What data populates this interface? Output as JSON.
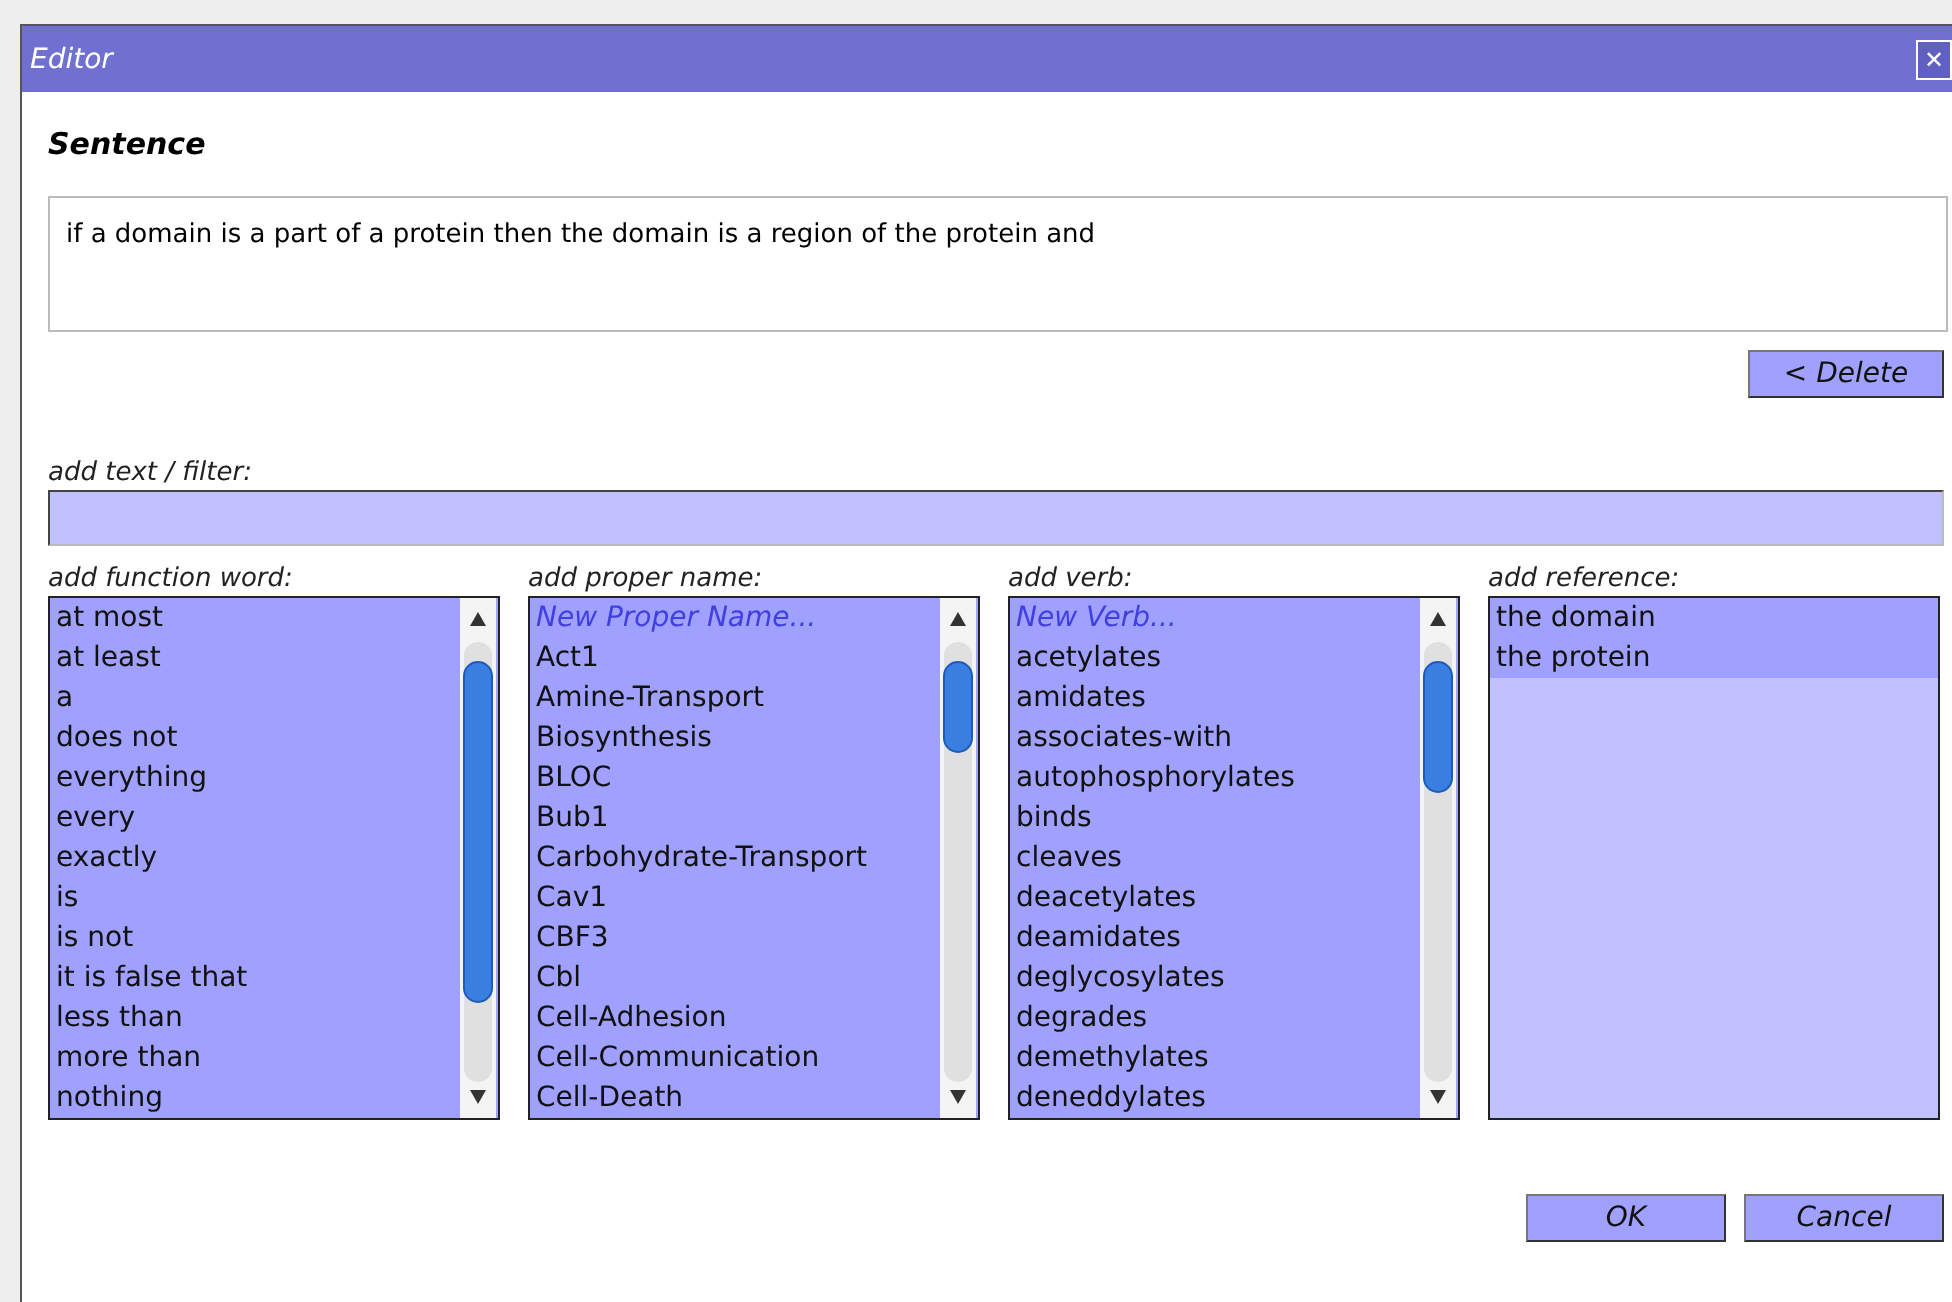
{
  "window": {
    "title": "Editor",
    "close": "✕"
  },
  "sentence": {
    "heading": "Sentence",
    "value": "if a domain is a part of a protein then the domain is a region of the protein and"
  },
  "delete_button": "< Delete",
  "filter": {
    "label": "add text / filter:"
  },
  "lists": [
    {
      "label": "add function word:",
      "kind": "scroll",
      "items": [
        {
          "text": "at most",
          "kind": "word"
        },
        {
          "text": "at least",
          "kind": "word"
        },
        {
          "text": "a",
          "kind": "word"
        },
        {
          "text": "does not",
          "kind": "word"
        },
        {
          "text": "everything",
          "kind": "word"
        },
        {
          "text": "every",
          "kind": "word"
        },
        {
          "text": "exactly",
          "kind": "word"
        },
        {
          "text": "is",
          "kind": "word"
        },
        {
          "text": "is not",
          "kind": "word"
        },
        {
          "text": "it is false that",
          "kind": "word"
        },
        {
          "text": "less than",
          "kind": "word"
        },
        {
          "text": "more than",
          "kind": "word"
        },
        {
          "text": "nothing",
          "kind": "word"
        }
      ]
    },
    {
      "label": "add proper name:",
      "kind": "scroll",
      "items": [
        {
          "text": "New Proper Name...",
          "kind": "new"
        },
        {
          "text": "Act1",
          "kind": "word"
        },
        {
          "text": "Amine-Transport",
          "kind": "word"
        },
        {
          "text": "Biosynthesis",
          "kind": "word"
        },
        {
          "text": "BLOC",
          "kind": "word"
        },
        {
          "text": "Bub1",
          "kind": "word"
        },
        {
          "text": "Carbohydrate-Transport",
          "kind": "word"
        },
        {
          "text": "Cav1",
          "kind": "word"
        },
        {
          "text": "CBF3",
          "kind": "word"
        },
        {
          "text": "Cbl",
          "kind": "word"
        },
        {
          "text": "Cell-Adhesion",
          "kind": "word"
        },
        {
          "text": "Cell-Communication",
          "kind": "word"
        },
        {
          "text": "Cell-Death",
          "kind": "word"
        }
      ]
    },
    {
      "label": "add verb:",
      "kind": "scroll",
      "items": [
        {
          "text": "New Verb...",
          "kind": "new"
        },
        {
          "text": "acetylates",
          "kind": "word"
        },
        {
          "text": "amidates",
          "kind": "word"
        },
        {
          "text": "associates-with",
          "kind": "word"
        },
        {
          "text": "autophosphorylates",
          "kind": "word"
        },
        {
          "text": "binds",
          "kind": "word"
        },
        {
          "text": "cleaves",
          "kind": "word"
        },
        {
          "text": "deacetylates",
          "kind": "word"
        },
        {
          "text": "deamidates",
          "kind": "word"
        },
        {
          "text": "deglycosylates",
          "kind": "word"
        },
        {
          "text": "degrades",
          "kind": "word"
        },
        {
          "text": "demethylates",
          "kind": "word"
        },
        {
          "text": "deneddylates",
          "kind": "word"
        }
      ]
    },
    {
      "label": "add reference:",
      "kind": "plain",
      "items": [
        {
          "text": "the domain",
          "kind": "word"
        },
        {
          "text": "the protein",
          "kind": "word"
        }
      ]
    }
  ],
  "buttons": [
    "OK",
    "Cancel"
  ]
}
